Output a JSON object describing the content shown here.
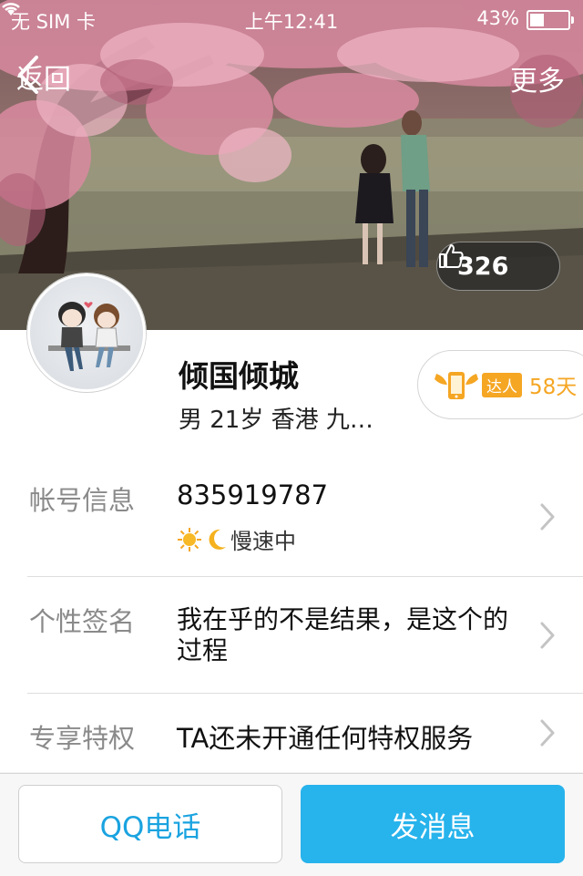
{
  "status_bar": {
    "carrier": "无 SIM 卡",
    "time": "上午12:41",
    "battery": "43%",
    "battery_level": 0.43
  },
  "nav": {
    "back_label": "返回",
    "more_label": "更多"
  },
  "cover": {
    "like_count": "326"
  },
  "profile": {
    "nickname": "倾国倾城",
    "basic_info": "男  21岁  香港 九…",
    "badge_label": "达人",
    "badge_days": "58天"
  },
  "info": {
    "account": {
      "label": "帐号信息",
      "value": "835919787",
      "status": "慢速中"
    },
    "signature": {
      "label": "个性签名",
      "value": "我在乎的不是结果，是这个的过程"
    },
    "privilege": {
      "label": "专享特权",
      "value": "TA还未开通任何特权服务"
    }
  },
  "actions": {
    "call_label": "QQ电话",
    "message_label": "发消息"
  },
  "colors": {
    "accent": "#27b3ec",
    "accent_text": "#1aa3e0",
    "badge": "#f5a623"
  }
}
